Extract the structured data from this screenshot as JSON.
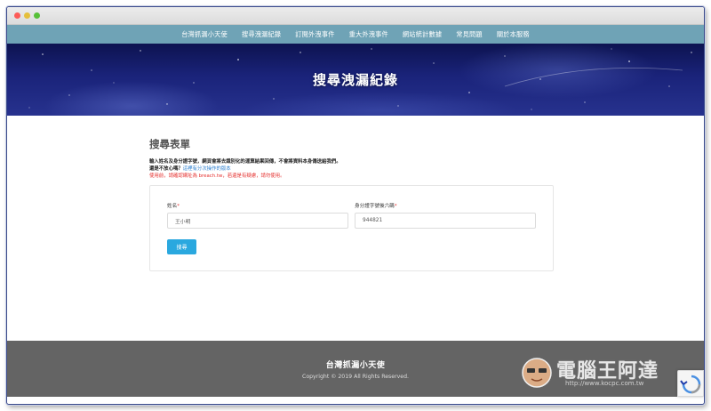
{
  "nav": {
    "items": [
      "台灣抓漏小天使",
      "搜尋洩漏紀錄",
      "訂閱外洩事件",
      "重大外洩事件",
      "網站統計數據",
      "常見問題",
      "關於本服務"
    ]
  },
  "hero": {
    "title": "搜尋洩漏紀錄"
  },
  "form": {
    "title": "搜尋表單",
    "intro": "輸入姓名及身分證字號，網頁會將去識別化的運算結果回傳，不會將資料本身傳送給我們。",
    "question": "還是不放心嗎？",
    "question_link": "這裡有分次操作的版本",
    "warning": "使用前，請確認網址為 breach.tw，若還是有疑慮，請勿使用。",
    "name_label": "姓名",
    "name_value": "王小明",
    "id_label": "身分證字號後六碼",
    "id_value": "944821",
    "required_mark": "*",
    "submit_label": "搜尋"
  },
  "footer": {
    "title": "台灣抓漏小天使",
    "copyright": "Copyright © 2019 All Rights Reserved."
  },
  "watermark": {
    "text": "電腦王阿達",
    "url": "http://www.kocpc.com.tw"
  },
  "colors": {
    "navbar": "#6fa3b6",
    "hero": "#1a237a",
    "button": "#2aa8df",
    "warning": "#e5312f",
    "link": "#2d7fcf",
    "footer": "#646464"
  }
}
